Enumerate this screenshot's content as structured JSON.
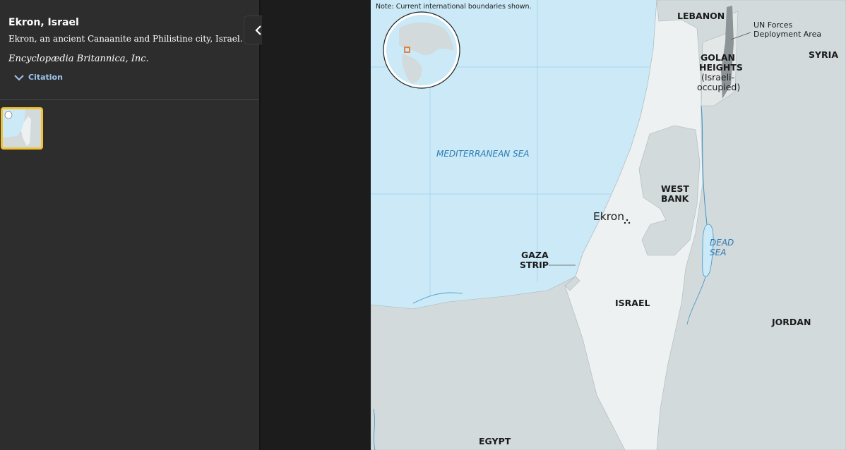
{
  "caption": {
    "title": "Ekron, Israel",
    "description": "Ekron, an ancient Canaanite and Philistine city, Israel.",
    "credit": "Encyclopædia Britannica, Inc.",
    "citation_label": "Citation"
  },
  "collapse_icon": "chevron-left-icon",
  "map": {
    "note": "Note: Current international boundaries shown.",
    "labels": {
      "lebanon": "LEBANON",
      "un_forces_1": "UN Forces",
      "un_forces_2": "Deployment Area",
      "golan_1": "GOLAN",
      "golan_2": "HEIGHTS",
      "golan_3": "(Israeli-",
      "golan_4": "occupied)",
      "syria": "SYRIA",
      "med_sea": "MEDITERRANEAN SEA",
      "west_bank_1": "WEST",
      "west_bank_2": "BANK",
      "ekron": "Ekron",
      "dead_sea_1": "DEAD",
      "dead_sea_2": "SEA",
      "gaza_1": "GAZA",
      "gaza_2": "STRIP",
      "israel": "ISRAEL",
      "jordan": "JORDAN",
      "egypt": "EGYPT"
    },
    "colors": {
      "sea": "#cbe9f7",
      "israel": "#eef1f1",
      "neighbors": "#d2dadb",
      "water_label": "#2b7bb4",
      "locator": "#e8772e"
    }
  }
}
